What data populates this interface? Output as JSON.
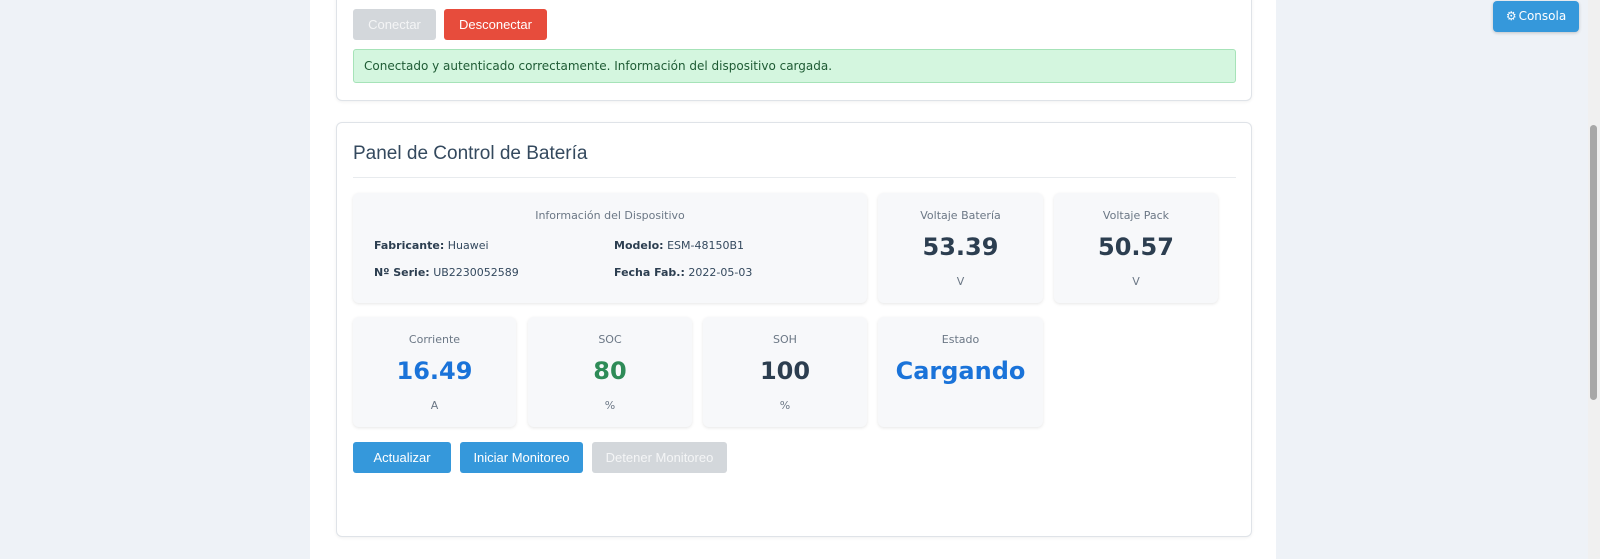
{
  "connection": {
    "connect_label": "Conectar",
    "disconnect_label": "Desconectar",
    "status_message": "Conectado y autenticado correctamente. Información del dispositivo cargada."
  },
  "panel": {
    "title": "Panel de Control de Batería",
    "device_info": {
      "heading": "Información del Dispositivo",
      "manufacturer_label": "Fabricante:",
      "manufacturer_value": "Huawei",
      "model_label": "Modelo:",
      "model_value": "ESM-48150B1",
      "serial_label": "Nº Serie:",
      "serial_value": "UB2230052589",
      "date_label": "Fecha Fab.:",
      "date_value": "2022-05-03"
    },
    "metrics": {
      "battery_voltage": {
        "label": "Voltaje Batería",
        "value": "53.39",
        "unit": "V"
      },
      "pack_voltage": {
        "label": "Voltaje Pack",
        "value": "50.57",
        "unit": "V"
      },
      "current": {
        "label": "Corriente",
        "value": "16.49",
        "unit": "A"
      },
      "soc": {
        "label": "SOC",
        "value": "80",
        "unit": "%"
      },
      "soh": {
        "label": "SOH",
        "value": "100",
        "unit": "%"
      },
      "state": {
        "label": "Estado",
        "value": "Cargando"
      }
    },
    "actions": {
      "refresh_label": "Actualizar",
      "start_label": "Iniciar Monitoreo",
      "stop_label": "Detener Monitoreo"
    }
  },
  "console": {
    "label": "Consola",
    "icon": "gear-icon"
  },
  "colors": {
    "primary": "#3598db",
    "danger": "#e74c3c",
    "success_value": "#2e8b57",
    "info_value": "#1a73d9",
    "disabled": "#d3d7db"
  }
}
